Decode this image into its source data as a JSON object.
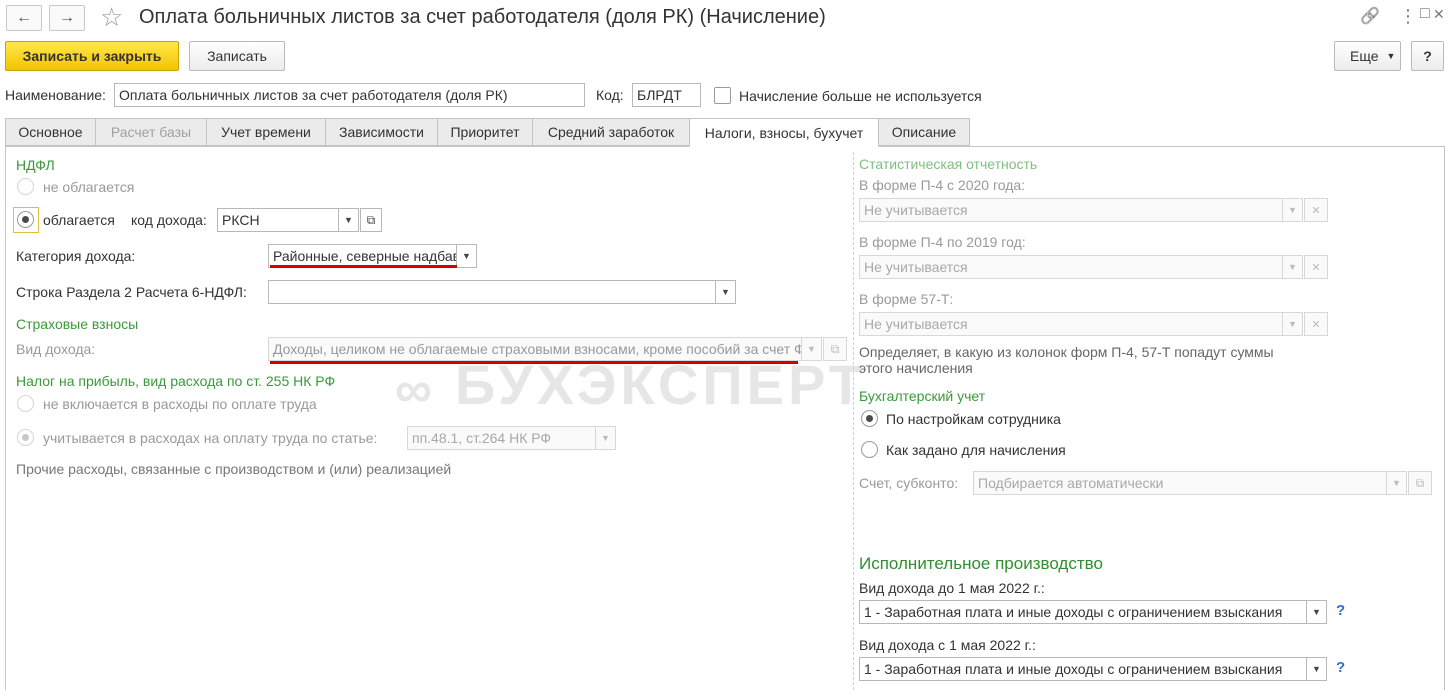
{
  "window": {
    "title": "Оплата больничных листов за счет работодателя (доля РК) (Начисление)",
    "back_icon": "←",
    "forward_icon": "→",
    "star_icon": "☆",
    "link_icon": "🔗",
    "menu_icon": "⋮",
    "maximize_icon": "□",
    "close_icon": "✕"
  },
  "toolbar": {
    "save_close_label": "Записать и закрыть",
    "save_label": "Записать",
    "more_label": "Еще",
    "help_label": "?"
  },
  "header": {
    "name_label": "Наименование:",
    "name_value": "Оплата больничных листов за счет работодателя (доля РК)",
    "code_label": "Код:",
    "code_value": "БЛРДТ",
    "unused_label": "Начисление больше не используется"
  },
  "tabs": [
    {
      "label": "Основное"
    },
    {
      "label": "Расчет базы"
    },
    {
      "label": "Учет времени"
    },
    {
      "label": "Зависимости"
    },
    {
      "label": "Приоритет"
    },
    {
      "label": "Средний заработок"
    },
    {
      "label": "Налоги, взносы, бухучет"
    },
    {
      "label": "Описание"
    }
  ],
  "ndfl": {
    "section": "НДФЛ",
    "not_taxed": "не облагается",
    "taxed": "облагается",
    "income_code_label": "код дохода:",
    "income_code_value": "РКСН",
    "category_label": "Категория дохода:",
    "category_value": "Районные, северные надбавки",
    "row_label": "Строка Раздела 2 Расчета 6-НДФЛ:",
    "row_value": ""
  },
  "insurance": {
    "section": "Страховые взносы",
    "income_type_label": "Вид дохода:",
    "income_type_value": "Доходы, целиком не облагаемые страховыми взносами, кроме пособий за счет ФСС и денежного довольствия военнослужащих"
  },
  "profit_tax": {
    "section": "Налог на прибыль, вид расхода по ст. 255 НК РФ",
    "not_included": "не включается в расходы по оплате труда",
    "included": "учитывается в расходах на оплату труда по статье:",
    "article_value": "пп.48.1, ст.264 НК РФ",
    "other_expenses": "Прочие расходы, связанные с производством и (или) реализацией"
  },
  "stats": {
    "section": "Статистическая отчетность",
    "p4_2020_label": "В форме П-4 с 2020 года:",
    "p4_2020_value": "Не учитывается",
    "p4_2019_label": "В форме П-4 по 2019 год:",
    "p4_2019_value": "Не учитывается",
    "f57_label": "В форме 57-Т:",
    "f57_value": "Не учитывается",
    "note": "Определяет, в какую из колонок форм П-4, 57-Т попадут суммы этого начисления"
  },
  "accounting": {
    "section": "Бухгалтерский учет",
    "by_employee": "По настройкам сотрудника",
    "as_set": "Как задано для начисления",
    "account_label": "Счет, субконто:",
    "account_placeholder": "Подбирается автоматически"
  },
  "enforcement": {
    "section": "Исполнительное производство",
    "before_label": "Вид дохода до 1 мая 2022 г.:",
    "before_value": "1 - Заработная плата и иные доходы с ограничением взыскания",
    "after_label": "Вид дохода с 1 мая 2022 г.:",
    "after_value": "1 - Заработная плата и иные доходы с ограничением взыскания"
  },
  "watermark": "БУХЭКСПЕРТ",
  "watermark_logo": "∞"
}
